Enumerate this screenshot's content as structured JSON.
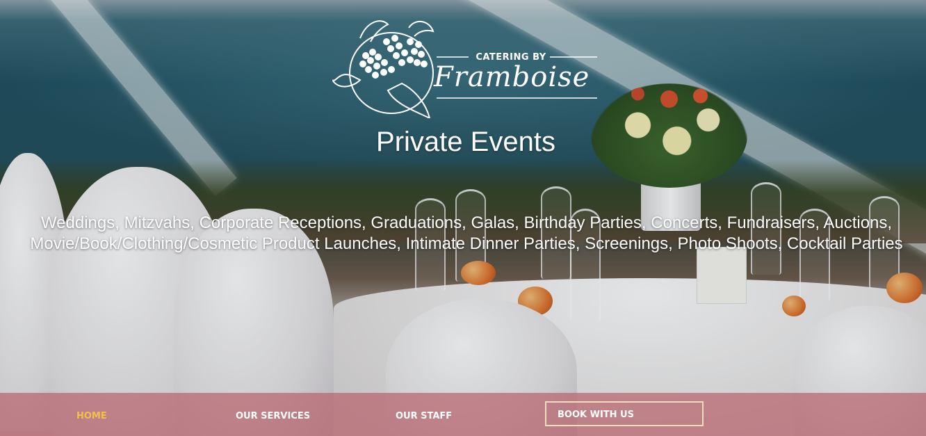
{
  "brand": {
    "caption": "CATERING BY",
    "name": "Framboise"
  },
  "hero": {
    "title": "Private Events",
    "event_types": "Weddings, Mitzvahs, Corporate Receptions, Graduations, Galas, Birthday Parties, Concerts, Fundraisers, Auctions, Movie/Book/Clothing/Cosmetic Product Launches, Intimate Dinner Parties, Screenings, Photo Shoots, Cocktail Parties"
  },
  "nav": {
    "items": [
      {
        "label": "HOME",
        "active": true
      },
      {
        "label": "OUR SERVICES",
        "active": false
      },
      {
        "label": "OUR STAFF",
        "active": false
      }
    ],
    "cta_label": "BOOK WITH US"
  },
  "colors": {
    "nav_background": "#b8646e",
    "nav_active": "#f2c14a",
    "cta_border": "#f1dcbc",
    "text": "#ffffff"
  },
  "icons": {
    "logo": "raspberry-logo-icon"
  }
}
